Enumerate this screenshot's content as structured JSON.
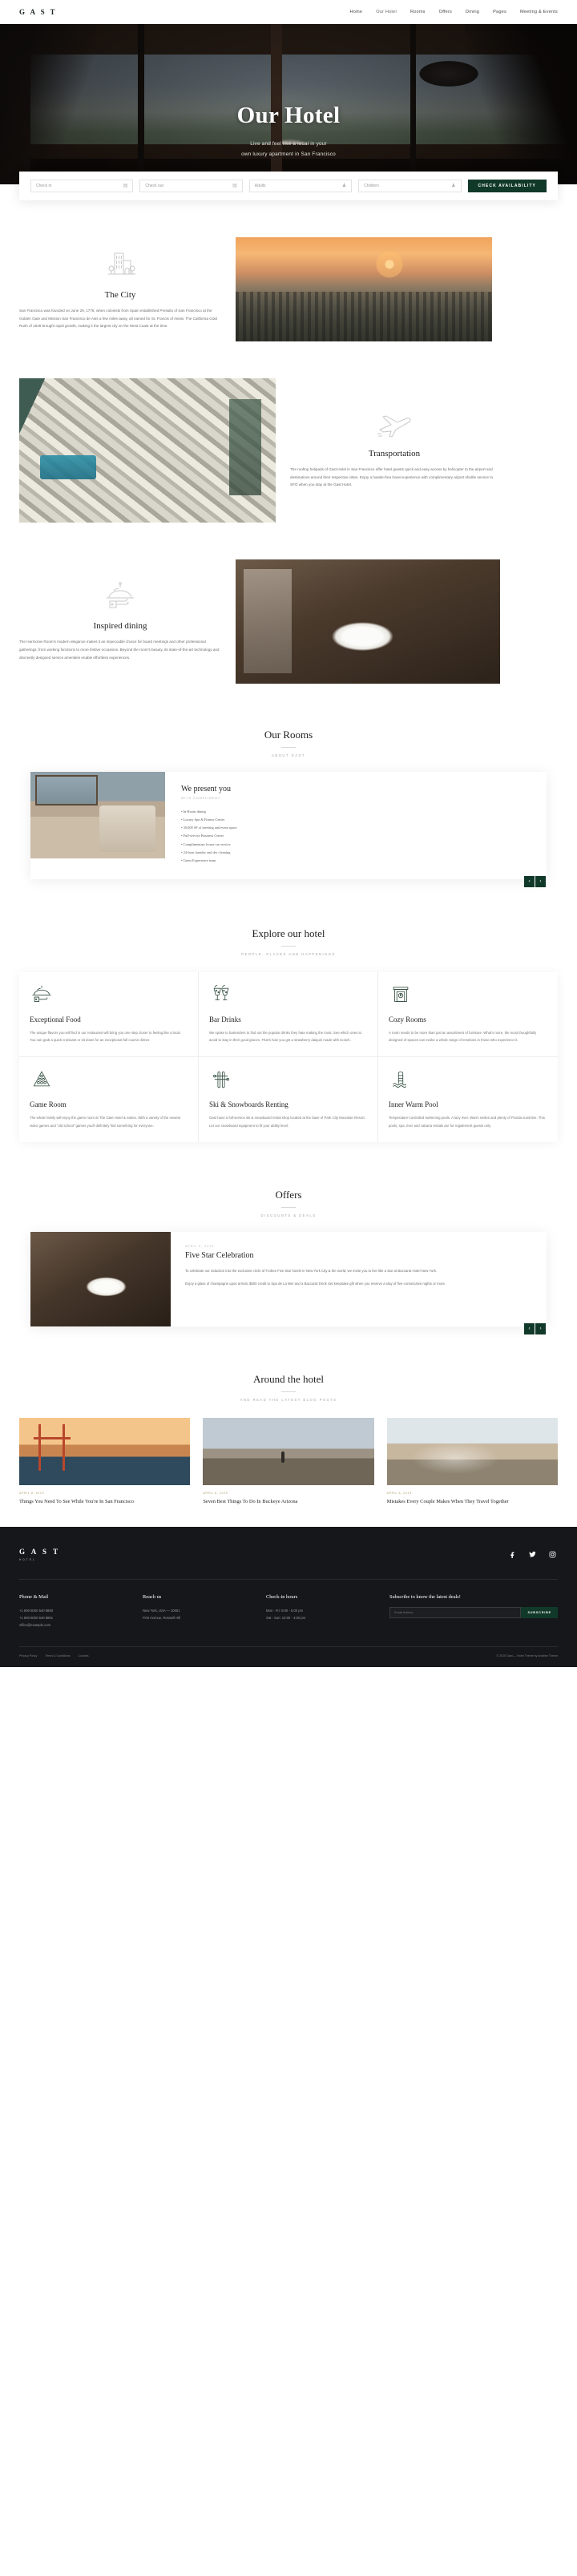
{
  "header": {
    "brand": "G A S T",
    "nav": [
      {
        "label": "Home",
        "active": false
      },
      {
        "label": "Our Hotel",
        "active": true
      },
      {
        "label": "Rooms",
        "active": false
      },
      {
        "label": "Offers",
        "active": false
      },
      {
        "label": "Dining",
        "active": false
      },
      {
        "label": "Pages",
        "active": false
      },
      {
        "label": "Meeting & Events",
        "active": false
      }
    ]
  },
  "hero": {
    "title": "Our Hotel",
    "subtitle_line1": "Live and feel like a local in your",
    "subtitle_line2": "own luxury apartment in San Francisco"
  },
  "booking": {
    "checkin": "Check in",
    "checkout": "Check out",
    "adults": "Adults",
    "children": "Children",
    "button": "CHECK AVAILABILITY",
    "calendar_icon": "▤",
    "person_icon": "♟",
    "accent": "#11392a"
  },
  "city": {
    "icon": "building-icon",
    "title": "The City",
    "body": "San Francisco was founded on June 29, 1776, when colonists from Spain established Presidio of San Francisco at the Golden Gate and Mission San Francisco de Asis a few miles away, all named for St. Francis of Assisi. The California Gold Rush of 1849 brought rapid growth, making it the largest city on the West Coast at the time."
  },
  "transportation": {
    "icon": "airplane-icon",
    "title": "Transportation",
    "body": "The rooftop helipads of Gast Hotel in San Francisco offer hotel guests quick and easy access by helicopter to the airport and destinations around their respective cities. Enjoy a hassle-free travel experience with complimentary airport shuttle service to SFO when you stay at the Gast Hotel."
  },
  "dining": {
    "icon": "room-service-icon",
    "title": "Inspired dining",
    "body": "The Harmonie Room's modern elegance makes it an impeccable choice for board meetings and other professional gatherings, from working functions to more festive occasions. Beyond the room's beauty, its state-of-the-art technology and discreetly designed service amenities enable effortless experiences."
  },
  "rooms": {
    "title": "Our Rooms",
    "kicker": "ABOUT GAST",
    "card": {
      "title": "We present you",
      "kicker": "WITH COMPLIMENT",
      "items": [
        "In-Room dining",
        "Luxury Spa & Fitness Center",
        "30,000 SF of meeting and event space",
        "Full-service Business Center",
        "Complimentary house car service",
        "24-hour laundry and dry cleaning",
        "Guest Experience team"
      ],
      "prev_icon": "‹",
      "next_icon": "›"
    }
  },
  "explore": {
    "title": "Explore our hotel",
    "kicker": "PEOPLE, PLACES AND HAPPENINGS",
    "features": [
      {
        "icon": "room-service-icon",
        "title": "Exceptional Food",
        "body": "The unique flavors you will find in our restaurant will bring you one step closer to feeling like a local. You can grab a quick croissant or sit down for an exceptional full course dinner."
      },
      {
        "icon": "cocktails-icon",
        "title": "Bar Drinks",
        "body": "We spoke to bartenders to find out the popular drinks they hate making the most. See which ones to avoid to stay in their good graces. That's how you get a strawberry daiquiri made with scotch."
      },
      {
        "icon": "fireplace-icon",
        "title": "Cozy Rooms",
        "body": "A room needs to be more than just an assortment of furniture. What's more, the most thoughtfully designed of spaces can evoke a whole range of emotions in those who experience it."
      },
      {
        "icon": "billiards-icon",
        "title": "Game Room",
        "body": "The whole family will enjoy the game room at The Gast Hotel & Suites. With a variety of the newest video games and \"old school\" games you'll definitely find something for everyone."
      },
      {
        "icon": "skis-icon",
        "title": "Ski & Snowboards Renting",
        "body": "Gast have a full-service ski & snowboard rental shop located at the base of Park City Mountain Resort. Let our snowboard equipment to fit your ability level."
      },
      {
        "icon": "pool-ladder-icon",
        "title": "Inner Warm Pool",
        "body": "Temperature-controlled swimming pools. A lazy river. Warm smiles and plenty of Florida sunshine. This pools, spa, river and cabana rentals are for regalement guests only."
      }
    ]
  },
  "offers": {
    "title": "Offers",
    "kicker": "DISCOUNTS & DEALS",
    "card": {
      "kicker": "APRIL 8, 2019",
      "title": "Five Star Celebration",
      "body1": "To celebrate our induction into the exclusive circle of Forbes Five Star hotels in New York City & the world, we invite you to live like a star at Baccarat Hotel New York.",
      "body2": "Enjoy a glass of champagne upon arrival, $500 credit to Spa de La Mer and a Baccarat Drink Set keepsake gift when you reserve a stay of five consecutive nights or more.",
      "prev_icon": "‹",
      "next_icon": "›"
    }
  },
  "blog": {
    "title": "Around the hotel",
    "kicker": "AND READ THE LATEST BLOG POSTS",
    "posts": [
      {
        "date": "April 8, 2019",
        "title": "Things You Need To See While You're In San Francisco",
        "thumb": "golden-gate-bridge"
      },
      {
        "date": "April 8, 2019",
        "title": "Seven Best Things To Do In Buckeye Arizona",
        "thumb": "desert-hiker"
      },
      {
        "date": "April 8, 2019",
        "title": "Mistakes Every Couple Makes When They Travel Together",
        "thumb": "couple-travel"
      }
    ]
  },
  "footer": {
    "brand": "G A S T",
    "brand_sub": "HOTEL",
    "socials": [
      {
        "icon": "facebook-icon",
        "glyph": "f"
      },
      {
        "icon": "twitter-icon",
        "glyph": "🐦"
      },
      {
        "icon": "instagram-icon",
        "glyph": "◙"
      }
    ],
    "columns": [
      {
        "title": "Phone & Mail",
        "lines": [
          "+1 800 8000 540 8890",
          "+1 800 8000 540 8891",
          "office@example.com"
        ]
      },
      {
        "title": "Reach us",
        "lines": [
          "New York, USA — 10001",
          "First Avenue, Roswell Hill"
        ]
      },
      {
        "title": "Check-in hours",
        "lines": [
          "Mon - Fri: 9:00 - 5:00 pm",
          "Sat - Sun: 10:00 - 4:00 pm"
        ]
      }
    ],
    "subscribe": {
      "title": "Subscribe to know the latest deals!",
      "placeholder": "Email Adress",
      "button": "SUBSCRIBE"
    },
    "bottom_links": [
      "Privacy Policy",
      "Terms & Conditions",
      "Cookies"
    ],
    "copyright": "© 2020 Gast — Hotel Theme by Another Theme"
  }
}
